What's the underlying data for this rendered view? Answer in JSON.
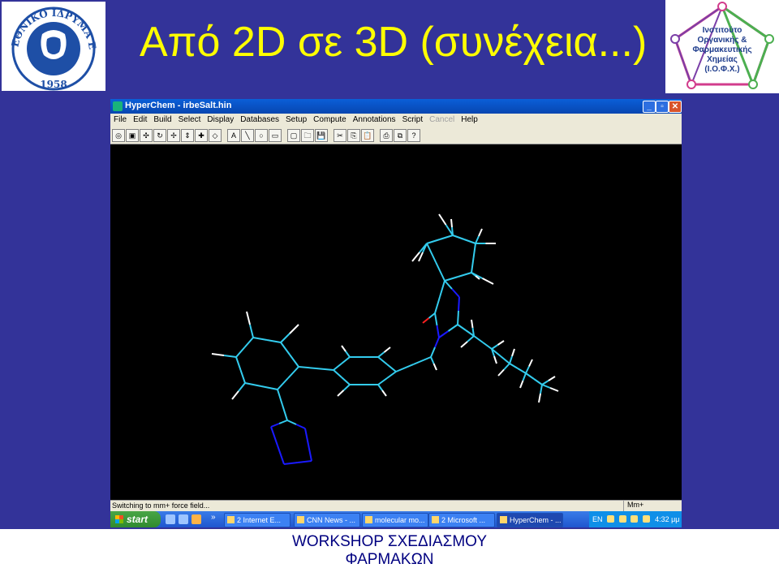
{
  "slide": {
    "title": "Από 2D σε 3D (συνέχεια...)",
    "footer_line1": "WORKSHOP ΣΧΕΔΙΑΣΜΟΥ",
    "footer_line2": "ΦΑΡΜΑΚΩΝ"
  },
  "logo_left": {
    "ring_text": "ΕΘΝΙΚΟ ΙΔΡΥΜΑ ΕΡΕΥΝΩΝ",
    "year": "1958"
  },
  "logo_right": {
    "line1": "Ινστιτούτο",
    "line2": "Οργανικής &",
    "line3": "Φαρμακευτικής",
    "line4": "Χημείας",
    "line5": "(Ι.Ο.Φ.Χ.)"
  },
  "window": {
    "title": "HyperChem - irbeSalt.hin",
    "menu": [
      {
        "label": "File"
      },
      {
        "label": "Edit"
      },
      {
        "label": "Build"
      },
      {
        "label": "Select"
      },
      {
        "label": "Display"
      },
      {
        "label": "Databases"
      },
      {
        "label": "Setup"
      },
      {
        "label": "Compute"
      },
      {
        "label": "Annotations"
      },
      {
        "label": "Script"
      },
      {
        "label": "Cancel",
        "disabled": true
      },
      {
        "label": "Help"
      }
    ],
    "toolbar_icons": [
      "draw-icon",
      "select-icon",
      "rotate-out-icon",
      "rotate-in-icon",
      "translate-icon",
      "translate-z-icon",
      "zoom-icon",
      "clip-icon",
      "text-icon",
      "line-icon",
      "circle-icon",
      "rectangle-icon",
      "new-icon",
      "open-icon",
      "save-icon",
      "cut-icon",
      "copy-icon",
      "paste-icon",
      "print-icon",
      "copy-image-icon",
      "help-icon"
    ],
    "toolbar_glyphs": [
      "◎",
      "▣",
      "✣",
      "↻",
      "✢",
      "⇕",
      "✚",
      "◇",
      "A",
      "╲",
      "○",
      "▭",
      "▢",
      "🗀",
      "💾",
      "✂",
      "⎘",
      "📋",
      "⎙",
      "⧉",
      "?"
    ],
    "status_text": "Switching to mm+ force field...",
    "status_mode": "Mm+",
    "colors": {
      "carbon": "#33ccee",
      "hydrogen": "#ffffff",
      "nitrogen": "#1a1aff",
      "oxygen": "#ff2020"
    }
  },
  "taskbar": {
    "start_label": "start",
    "quicklaunch_more": "»",
    "tasks": [
      {
        "label": "2 Internet E..."
      },
      {
        "label": "CNN News - ..."
      },
      {
        "label": "molecular mo..."
      },
      {
        "label": "2 Microsoft ..."
      },
      {
        "label": "HyperChem - ...",
        "active": true
      }
    ],
    "language": "EN",
    "clock": "4:32 μμ"
  }
}
